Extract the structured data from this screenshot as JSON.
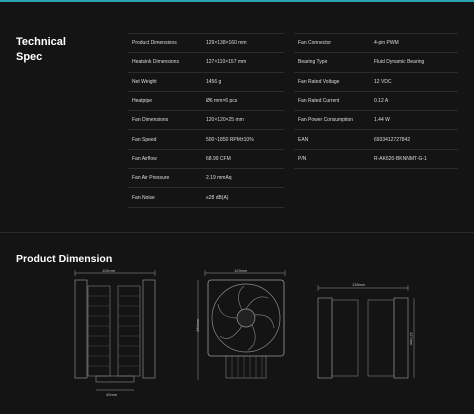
{
  "spec": {
    "title_line1": "Technical",
    "title_line2": "Spec",
    "left": [
      {
        "label": "Product Dimensions",
        "value": "129×138×160 mm"
      },
      {
        "label": "Heatsink Dimensions",
        "value": "127×110×157 mm"
      },
      {
        "label": "Net Weight",
        "value": "1456 g"
      },
      {
        "label": "Heatpipe",
        "value": "Ø6 mm×6 pcs"
      },
      {
        "label": "Fan Dimensions",
        "value": "120×120×25 mm"
      },
      {
        "label": "Fan Speed",
        "value": "500~1850 RPM±10%"
      },
      {
        "label": "Fan Airflow",
        "value": "68.99 CFM"
      },
      {
        "label": "Fan Air Pressure",
        "value": "2.19 mmAq"
      },
      {
        "label": "Fan Noise",
        "value": "≤28 dB(A)"
      }
    ],
    "right": [
      {
        "label": "Fan Connector",
        "value": "4-pin PWM"
      },
      {
        "label": "Bearing Type",
        "value": "Fluid Dynamic Bearing"
      },
      {
        "label": "Fan Rated Voltage",
        "value": "12 VDC"
      },
      {
        "label": "Fan Rated Current",
        "value": "0.12 A"
      },
      {
        "label": "Fan Power Consumption",
        "value": "1.44 W"
      },
      {
        "label": "EAN",
        "value": "6933412727842"
      },
      {
        "label": "P/N",
        "value": "R-AK620-BKNNMT-G-1"
      }
    ]
  },
  "dimension": {
    "title": "Product Dimension",
    "side_width": "110mm",
    "side_base": "40mm",
    "front_width": "129mm",
    "front_height": "160mm",
    "top_width": "138mm",
    "top_depth": "127mm"
  },
  "colors": {
    "background": "#141414",
    "accent_line": "#2aa3b0",
    "drawing_stroke": "#9a9a9a"
  }
}
